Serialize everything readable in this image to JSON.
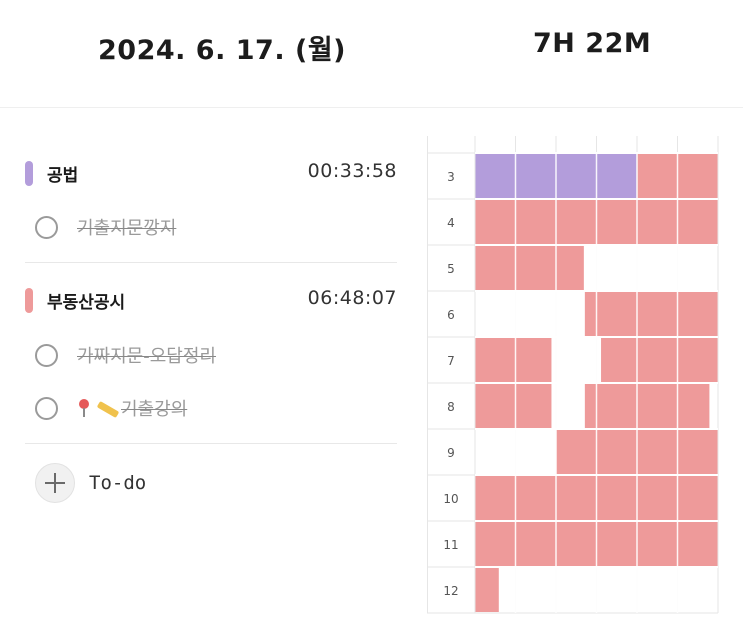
{
  "header": {
    "date": "2024. 6. 17. (월)",
    "total_time": "7H 22M"
  },
  "subjects": [
    {
      "name": "공법",
      "time": "00:33:58",
      "color": "#b39ddb",
      "tasks": [
        {
          "label": "기출지문깡지",
          "done": true
        }
      ]
    },
    {
      "name": "부동산공시",
      "time": "06:48:07",
      "color": "#ee9a9a",
      "tasks": [
        {
          "label": "가짜지문-오답정리",
          "done": true
        },
        {
          "label": "기출강의",
          "done": true,
          "icons": [
            "pin-icon",
            "pencil-icon"
          ]
        }
      ]
    }
  ],
  "todo": {
    "label": "To-do",
    "icon": "plus-icon"
  },
  "timetable": {
    "hours": [
      "3",
      "4",
      "5",
      "6",
      "7",
      "8",
      "9",
      "10",
      "11",
      "12"
    ],
    "minutes_per_cell": 10,
    "colors": {
      "공법": "#b39ddb",
      "부동산공시": "#ee9a9a"
    },
    "blocks": [
      {
        "hour": "3",
        "start_min": 0,
        "end_min": 40,
        "subject": "공법"
      },
      {
        "hour": "3",
        "start_min": 40,
        "end_min": 60,
        "subject": "부동산공시"
      },
      {
        "hour": "4",
        "start_min": 0,
        "end_min": 60,
        "subject": "부동산공시"
      },
      {
        "hour": "5",
        "start_min": 0,
        "end_min": 27,
        "subject": "부동산공시"
      },
      {
        "hour": "6",
        "start_min": 27,
        "end_min": 60,
        "subject": "부동산공시"
      },
      {
        "hour": "7",
        "start_min": 0,
        "end_min": 19,
        "subject": "부동산공시"
      },
      {
        "hour": "7",
        "start_min": 31,
        "end_min": 60,
        "subject": "부동산공시"
      },
      {
        "hour": "8",
        "start_min": 0,
        "end_min": 19,
        "subject": "부동산공시"
      },
      {
        "hour": "8",
        "start_min": 27,
        "end_min": 58,
        "subject": "부동산공시"
      },
      {
        "hour": "9",
        "start_min": 20,
        "end_min": 60,
        "subject": "부동산공시"
      },
      {
        "hour": "10",
        "start_min": 0,
        "end_min": 60,
        "subject": "부동산공시"
      },
      {
        "hour": "11",
        "start_min": 0,
        "end_min": 60,
        "subject": "부동산공시"
      },
      {
        "hour": "12",
        "start_min": 0,
        "end_min": 6,
        "subject": "부동산공시"
      }
    ]
  }
}
